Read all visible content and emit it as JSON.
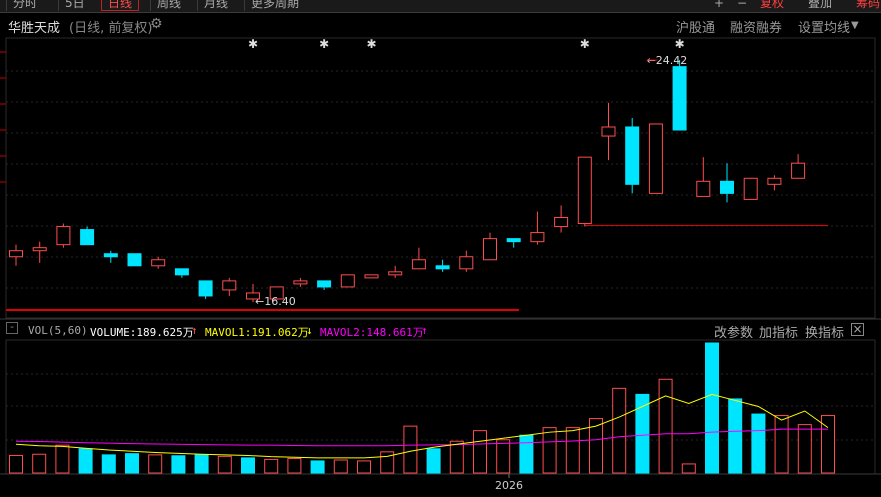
{
  "toolbar": {
    "tabs": [
      "分时",
      "5日",
      "日线",
      "周线",
      "月线",
      "更多周期"
    ],
    "active_tab": "日线",
    "plus_label": "+",
    "minus_label": "−",
    "fuquan_label": "复权",
    "overlay_label": "叠加",
    "extra_label": "筹码"
  },
  "header": {
    "stock_name": "华胜天成",
    "mode": "(日线, 前复权)",
    "links": [
      "沪股通",
      "融资融券",
      "设置均线"
    ]
  },
  "volume_panel": {
    "indicator": "VOL(5,60)",
    "volume_label": "VOLUME:189.625万",
    "volume_arrow": "↑",
    "mavol1_label": "MAVOL1:191.062万",
    "mavol1_arrow": "↓",
    "mavol2_label": "MAVOL2:148.661万",
    "mavol2_arrow": "↑",
    "buttons": [
      "改参数",
      "加指标",
      "换指标"
    ]
  },
  "colors": {
    "up": "#ff4d4d",
    "down": "#00e5ff",
    "mavol1": "#ffff00",
    "mavol2": "#ff00ff",
    "support_line": "#e00000"
  },
  "chart_data": {
    "type": "candlestick",
    "x_axis_label": "2026",
    "max_annotation": "24.42",
    "min_annotation": "16.40",
    "candles": [
      {
        "o": 17.9,
        "c": 18.1,
        "h": 18.3,
        "l": 17.6
      },
      {
        "o": 18.1,
        "c": 18.2,
        "h": 18.4,
        "l": 17.7
      },
      {
        "o": 18.3,
        "c": 18.9,
        "h": 19.0,
        "l": 18.2
      },
      {
        "o": 18.8,
        "c": 18.3,
        "h": 18.9,
        "l": 18.3
      },
      {
        "o": 18.0,
        "c": 17.9,
        "h": 18.1,
        "l": 17.7
      },
      {
        "o": 18.0,
        "c": 17.6,
        "h": 18.0,
        "l": 17.6
      },
      {
        "o": 17.6,
        "c": 17.8,
        "h": 17.9,
        "l": 17.5
      },
      {
        "o": 17.5,
        "c": 17.3,
        "h": 17.5,
        "l": 17.2
      },
      {
        "o": 17.1,
        "c": 16.6,
        "h": 17.1,
        "l": 16.5
      },
      {
        "o": 16.8,
        "c": 17.1,
        "h": 17.2,
        "l": 16.6
      },
      {
        "o": 16.5,
        "c": 16.7,
        "h": 17.0,
        "l": 16.4
      },
      {
        "o": 16.5,
        "c": 16.9,
        "h": 16.9,
        "l": 16.5
      },
      {
        "o": 17.0,
        "c": 17.1,
        "h": 17.2,
        "l": 16.9
      },
      {
        "o": 17.1,
        "c": 16.9,
        "h": 17.1,
        "l": 16.8
      },
      {
        "o": 16.9,
        "c": 17.3,
        "h": 17.3,
        "l": 16.9
      },
      {
        "o": 17.2,
        "c": 17.3,
        "h": 17.3,
        "l": 17.2
      },
      {
        "o": 17.3,
        "c": 17.4,
        "h": 17.6,
        "l": 17.2
      },
      {
        "o": 17.5,
        "c": 17.8,
        "h": 18.2,
        "l": 17.5
      },
      {
        "o": 17.6,
        "c": 17.5,
        "h": 17.8,
        "l": 17.4
      },
      {
        "o": 17.5,
        "c": 17.9,
        "h": 18.1,
        "l": 17.4
      },
      {
        "o": 17.8,
        "c": 18.5,
        "h": 18.7,
        "l": 17.8
      },
      {
        "o": 18.5,
        "c": 18.4,
        "h": 18.5,
        "l": 18.2
      },
      {
        "o": 18.4,
        "c": 18.7,
        "h": 19.4,
        "l": 18.3
      },
      {
        "o": 18.9,
        "c": 19.2,
        "h": 19.6,
        "l": 18.7
      },
      {
        "o": 19.0,
        "c": 21.2,
        "h": 21.2,
        "l": 18.9
      },
      {
        "o": 21.9,
        "c": 22.2,
        "h": 23.0,
        "l": 21.1
      },
      {
        "o": 22.2,
        "c": 20.3,
        "h": 22.5,
        "l": 20.0
      },
      {
        "o": 20.0,
        "c": 22.3,
        "h": 22.3,
        "l": 20.0
      },
      {
        "o": 24.2,
        "c": 22.1,
        "h": 24.42,
        "l": 22.1
      },
      {
        "o": 19.9,
        "c": 20.4,
        "h": 21.2,
        "l": 19.9
      },
      {
        "o": 20.4,
        "c": 20.0,
        "h": 21.0,
        "l": 19.7
      },
      {
        "o": 19.8,
        "c": 20.5,
        "h": 20.5,
        "l": 19.8
      },
      {
        "o": 20.3,
        "c": 20.5,
        "h": 20.6,
        "l": 20.1
      },
      {
        "o": 20.5,
        "c": 21.0,
        "h": 21.3,
        "l": 20.5
      }
    ],
    "volume": [
      0.58,
      0.62,
      0.92,
      0.8,
      0.6,
      0.64,
      0.6,
      0.57,
      0.6,
      0.55,
      0.5,
      0.45,
      0.48,
      0.4,
      0.43,
      0.4,
      0.7,
      1.55,
      0.8,
      1.05,
      1.4,
      1.1,
      1.25,
      1.5,
      1.5,
      1.8,
      2.8,
      2.6,
      3.1,
      0.3,
      4.3,
      2.45,
      1.95,
      1.9,
      1.6,
      1.9
    ],
    "volume_up": [
      true,
      true,
      true,
      false,
      false,
      false,
      true,
      false,
      false,
      true,
      false,
      true,
      true,
      false,
      true,
      true,
      true,
      true,
      false,
      true,
      true,
      true,
      false,
      true,
      true,
      true,
      true,
      false,
      true,
      true,
      false,
      false,
      false,
      true,
      true,
      true
    ],
    "mavol1": [
      0.95,
      0.9,
      0.88,
      0.82,
      0.76,
      0.72,
      0.68,
      0.65,
      0.62,
      0.6,
      0.58,
      0.54,
      0.52,
      0.5,
      0.5,
      0.5,
      0.55,
      0.72,
      0.85,
      0.95,
      1.05,
      1.15,
      1.25,
      1.35,
      1.4,
      1.55,
      1.85,
      2.2,
      2.55,
      2.3,
      2.6,
      2.4,
      2.2,
      1.75,
      2.05,
      1.5
    ],
    "mavol2": [
      1.05,
      1.04,
      1.02,
      1.0,
      0.99,
      0.97,
      0.96,
      0.95,
      0.94,
      0.93,
      0.92,
      0.92,
      0.91,
      0.9,
      0.9,
      0.9,
      0.9,
      0.92,
      0.93,
      0.94,
      0.96,
      0.98,
      1.0,
      1.03,
      1.06,
      1.1,
      1.2,
      1.25,
      1.3,
      1.3,
      1.35,
      1.38,
      1.4,
      1.45,
      1.45,
      1.45
    ],
    "star_indices": [
      10,
      13,
      15,
      24,
      28
    ],
    "support_levels": [
      16.4,
      19.0
    ]
  }
}
